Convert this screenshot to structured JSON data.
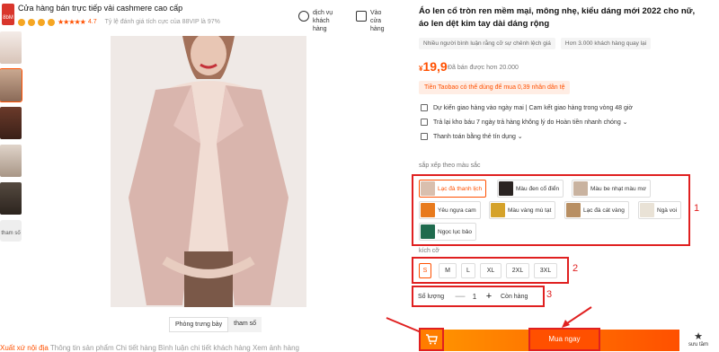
{
  "store": {
    "logo_text": "8bM",
    "name": "Cửa hàng bán trực tiếp vải cashmere cao cấp",
    "stars": "★★★★★",
    "score": "4.7",
    "rating_text": "Tỷ lệ đánh giá tích cực của 88VIP là 97%"
  },
  "header_buttons": [
    {
      "label_line1": "dịch vụ",
      "label_line2": "khách",
      "label_line3": "hàng",
      "icon": "headset-icon"
    },
    {
      "label_line1": "Vào",
      "label_line2": "cửa",
      "label_line3": "hàng",
      "icon": "store-icon"
    }
  ],
  "thumbs_more_label": "tham số",
  "view_tabs": [
    "Phòng trưng bày",
    "tham số"
  ],
  "footer_strip": {
    "left": "Xuất xứ nội địa",
    "rest": "Thông tin sản phẩm   Chi tiết hàng   Bình luận chi tiết khách hàng   Xem ảnh hàng"
  },
  "product": {
    "title": "Áo len cổ tròn ren mềm mại, mông nhẹ, kiểu dáng mới 2022 cho nữ, áo len dệt kim tay dài dáng rộng",
    "tags": [
      "Nhiều người bình luận rằng cỡ sự chênh lệch giá",
      "Hơn 3.000 khách hàng quay lại"
    ],
    "price_symbol": "¥",
    "price": "19,9",
    "sold": "Đã bán được hơn 20.000",
    "promo": "Tiền Taobao có thể dùng để mua 0,39 nhân dân tệ",
    "services": [
      "Dự kiến giao hàng vào ngày mai | Cam kết giao hàng trong vòng 48 giờ",
      "Trả lại kho báu     7 ngày trả hàng không lý do     Hoàn tiền nhanh chóng ⌄",
      "Thanh toán bằng thẻ tín dụng ⌄"
    ]
  },
  "colors": {
    "label": "sắp xếp theo màu sắc",
    "accent": "#ff5000",
    "annotation": "1",
    "options": [
      {
        "label": "Lạc đà thanh lịch",
        "swatch": "#d9bfae",
        "selected": true
      },
      {
        "label": "Màu đen cổ điển",
        "swatch": "#2a2422",
        "selected": false
      },
      {
        "label": "Màu be nhạt màu mơ",
        "swatch": "#c9b3a0",
        "selected": false
      },
      {
        "label": "Yêu ngựa cam",
        "swatch": "#e87a1c",
        "selected": false
      },
      {
        "label": "Màu vàng mù tạt",
        "swatch": "#d5a22a",
        "selected": false
      },
      {
        "label": "Lạc đà cát vàng",
        "swatch": "#b88f63",
        "selected": false
      },
      {
        "label": "Ngà voi",
        "swatch": "#e9e2d6",
        "selected": false
      },
      {
        "label": "Ngọc lục bảo",
        "swatch": "#1f6b4e",
        "selected": false
      }
    ]
  },
  "sizes": {
    "label": "kích cỡ",
    "annotation": "2",
    "options": [
      "S",
      "M",
      "L",
      "XL",
      "2XL",
      "3XL"
    ],
    "selected": "S"
  },
  "quantity": {
    "label": "Số lượng",
    "minus": "—",
    "value": "1",
    "plus": "+",
    "stock": "Còn hàng",
    "annotation": "3"
  },
  "actions": {
    "buy_now": "Mua ngay",
    "wishlist_icon": "★",
    "wishlist": "sưu tầm"
  }
}
